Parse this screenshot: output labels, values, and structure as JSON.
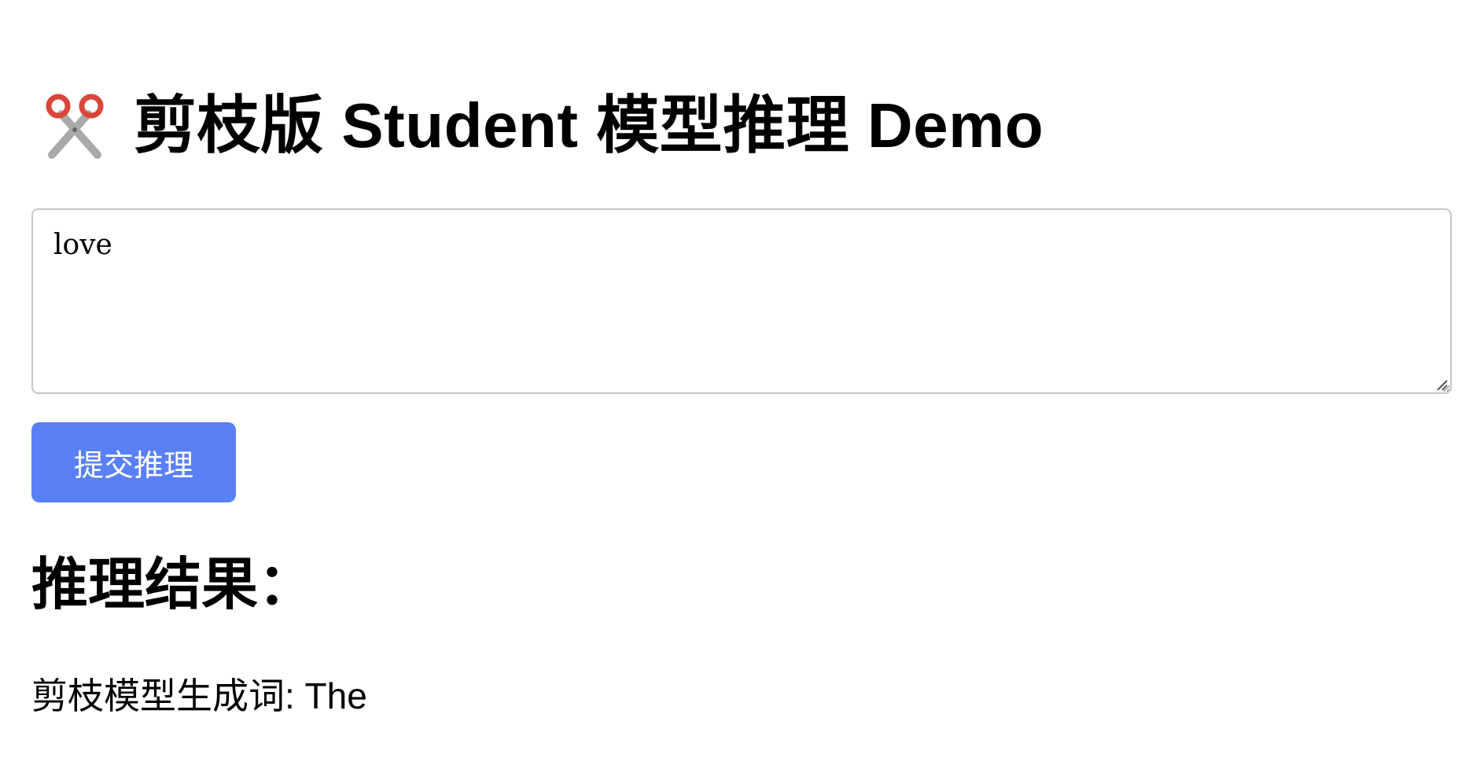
{
  "page": {
    "title_icon": "scissors-icon",
    "title": "剪枝版 Student 模型推理 Demo"
  },
  "form": {
    "input_value": "love",
    "submit_label": "提交推理"
  },
  "result": {
    "heading": "推理结果：",
    "text": "剪枝模型生成词: The"
  },
  "colors": {
    "button_bg": "#5a80f6",
    "button_text": "#ffffff",
    "icon_red": "#d9473b",
    "icon_gray": "#a9a9a9"
  }
}
